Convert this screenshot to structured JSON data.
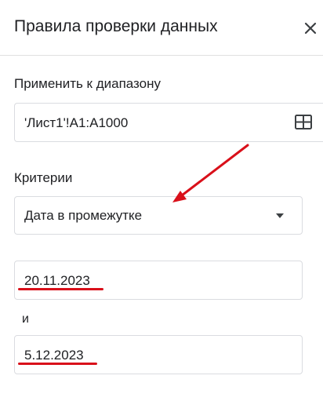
{
  "panel": {
    "title": "Правила проверки данных"
  },
  "range": {
    "label": "Применить к диапазону",
    "value": "'Лист1'!A1:A1000"
  },
  "criteria": {
    "label": "Критерии",
    "selected": "Дата в промежутке"
  },
  "between": {
    "start_value": "20.11.2023",
    "joiner": "и",
    "end_value": "5.12.2023"
  },
  "colors": {
    "annotation": "#d9101a",
    "border": "#dadce0",
    "text": "#202124"
  },
  "icons": {
    "close": "close-icon",
    "range_picker": "grid-icon",
    "dropdown": "caret-down-icon"
  }
}
